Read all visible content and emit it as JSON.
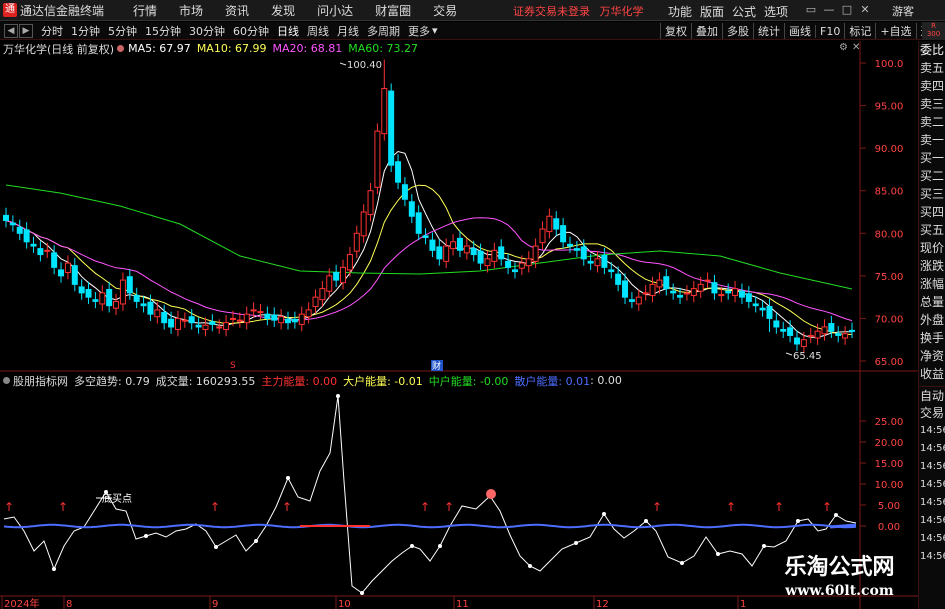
{
  "window": {
    "title": "通达信金融终端",
    "menu": [
      "行情",
      "市场",
      "资讯",
      "发现",
      "问小达",
      "财富圈",
      "交易"
    ],
    "broker_status": "证券交易未登录",
    "stock_short": "万华化学",
    "right_menu": [
      "功能",
      "版面",
      "公式",
      "选项"
    ],
    "guest": "游客"
  },
  "periods": {
    "items": [
      "分时",
      "1分钟",
      "5分钟",
      "15分钟",
      "30分钟",
      "60分钟",
      "日线",
      "周线",
      "月线",
      "多周期",
      "更多"
    ],
    "active": "日线"
  },
  "toolbar": [
    "复权",
    "叠加",
    "多股",
    "统计",
    "画线",
    "F10",
    "标记",
    "+自选",
    "返回"
  ],
  "up_ticker": {
    "top": "R",
    "bottom": "300"
  },
  "chart": {
    "stock_label": "万华化学(日线 前复权)",
    "ma5": "MA5: 67.97",
    "ma10": "MA10: 67.99",
    "ma20": "MA20: 68.81",
    "ma60": "MA60: 73.27",
    "high_label": "100.40",
    "low_label": "65.45",
    "marker_s": "S",
    "marker_cai": "财",
    "ylabels": [
      "100.0",
      "95.00",
      "90.00",
      "85.00",
      "80.00",
      "75.00",
      "70.00",
      "65.00"
    ]
  },
  "indicator": {
    "name": "股朋指标网",
    "trend": "多空趋势: 0.79",
    "volume": "成交量: 160293.55",
    "main_energy": "主力能量: 0.00",
    "big_energy": "大户能量: -0.01",
    "mid_energy": "中户能量: -0.00",
    "retail_energy": "散户能量: 0.01",
    "tail": ": 0.00",
    "buy_point_label": "底买点",
    "ylabels": [
      "25.00",
      "20.00",
      "15.00",
      "10.00",
      "5.00",
      "0.00"
    ]
  },
  "xaxis": {
    "labels": [
      "2024年",
      "8",
      "9",
      "10",
      "11",
      "12",
      "1"
    ]
  },
  "side_panel": {
    "order_book": [
      "委比",
      "卖五",
      "卖四",
      "卖三",
      "卖二",
      "卖一",
      "买一",
      "买二",
      "买三",
      "买四",
      "买五"
    ],
    "stats": [
      "现价",
      "涨跌",
      "涨幅",
      "总量",
      "外盘",
      "换手",
      "净资",
      "收益"
    ],
    "trade": [
      "自动",
      "交易"
    ],
    "times": [
      "14:56",
      "14:56",
      "14:56",
      "14:56",
      "14:56",
      "14:56",
      "14:56",
      "14:56"
    ]
  },
  "watermark": {
    "line1": "乐淘公式网",
    "line2": "www.60lt.com"
  },
  "colors": {
    "up": "#ff3232",
    "down": "#00e5ff",
    "ma5": "#ffffff",
    "ma10": "#ffff55",
    "ma20": "#ff55ff",
    "ma60": "#22dd22"
  }
}
